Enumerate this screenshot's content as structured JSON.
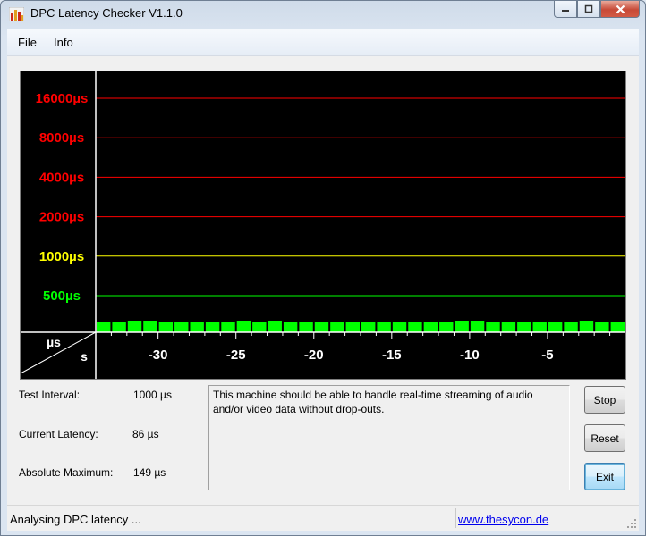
{
  "window": {
    "title": "DPC Latency Checker V1.1.0",
    "icon": "bar-graph-app-icon",
    "buttons": [
      "minimize",
      "restore",
      "close"
    ]
  },
  "menu": [
    "File",
    "Info"
  ],
  "chart_data": {
    "type": "bar",
    "y_scale": "log",
    "y_unit_label": "µs",
    "x_unit_label": "s",
    "y_levels": [
      {
        "label": "16000µs",
        "value": 16000,
        "color": "#ff0000"
      },
      {
        "label": "8000µs",
        "value": 8000,
        "color": "#ff0000"
      },
      {
        "label": "4000µs",
        "value": 4000,
        "color": "#ff0000"
      },
      {
        "label": "2000µs",
        "value": 2000,
        "color": "#ff0000"
      },
      {
        "label": "1000µs",
        "value": 1000,
        "color": "#ffff00"
      },
      {
        "label": "500µs",
        "value": 500,
        "color": "#00ff00"
      }
    ],
    "x_ticks": [
      "-30",
      "-25",
      "-20",
      "-15",
      "-10",
      "-5"
    ],
    "x_tick_values": [
      -30,
      -25,
      -20,
      -15,
      -10,
      -5
    ],
    "x_range": [
      -34,
      0
    ],
    "bar_color": "#00ff00",
    "values": [
      92,
      92,
      100,
      100,
      92,
      92,
      92,
      92,
      92,
      100,
      92,
      100,
      92,
      85,
      92,
      92,
      92,
      92,
      92,
      92,
      92,
      92,
      92,
      100,
      100,
      92,
      92,
      92,
      92,
      92,
      85,
      100,
      92,
      92
    ]
  },
  "info": {
    "test_interval_label": "Test Interval:",
    "test_interval_value": "1000 µs",
    "current_latency_label": "Current Latency:",
    "current_latency_value": "86 µs",
    "absolute_max_label": "Absolute Maximum:",
    "absolute_max_value": "149 µs"
  },
  "message": "This machine should be able to handle real-time streaming of audio and/or video data without drop-outs.",
  "buttons": {
    "stop": "Stop",
    "reset": "Reset",
    "exit": "Exit"
  },
  "status": {
    "text": "Analysing DPC latency ...",
    "link": "www.thesycon.de"
  }
}
